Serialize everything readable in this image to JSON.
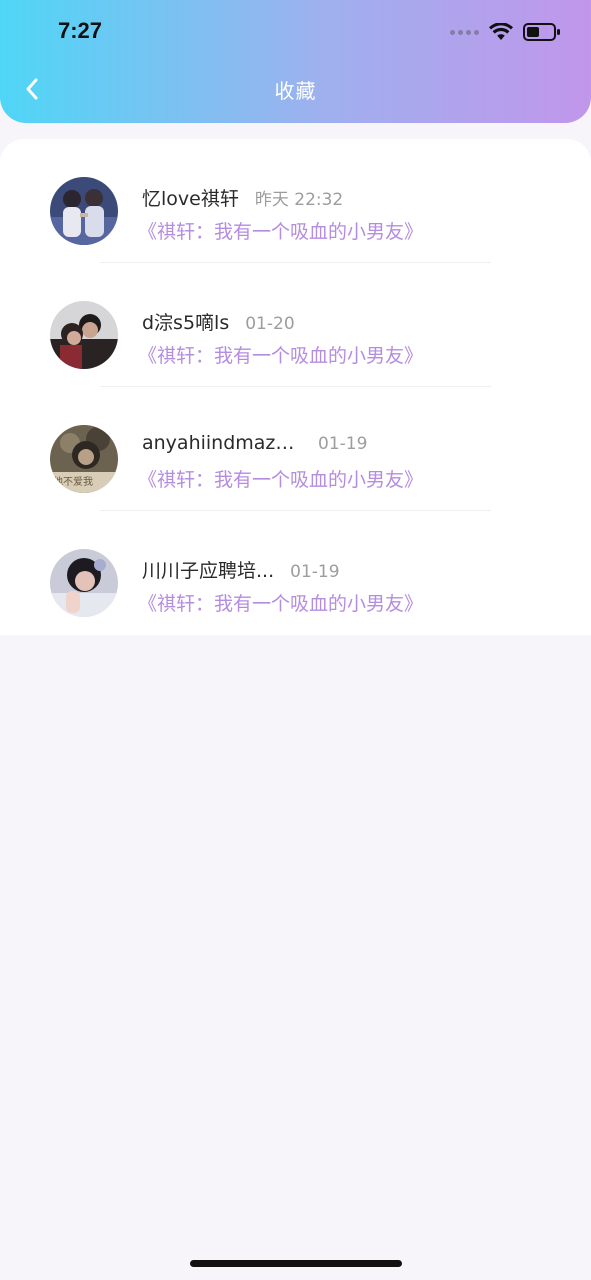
{
  "status_bar": {
    "time": "7:27"
  },
  "header": {
    "title": "收藏",
    "back_icon": "chevron-left-icon",
    "gradient": [
      "#4fd6f6",
      "#c196eb"
    ]
  },
  "items": [
    {
      "name": "忆love祺轩",
      "time": "昨天 22:32",
      "book": "《祺轩：我有一个吸血的小男友》",
      "avatar_icon": "avatar-photo"
    },
    {
      "name": "d淙s5嘀ls",
      "time": "01-20",
      "book": "《祺轩：我有一个吸血的小男友》",
      "avatar_icon": "avatar-photo"
    },
    {
      "name": "anyahiindmaza...",
      "time": "01-19",
      "book": "《祺轩：我有一个吸血的小男友》",
      "avatar_icon": "avatar-photo",
      "avatar_caption": "他不爱我"
    },
    {
      "name": "川川子应聘培...",
      "time": "01-19",
      "book": "《祺轩：我有一个吸血的小男友》",
      "avatar_icon": "avatar-photo"
    }
  ],
  "colors": {
    "accent_purple": "#b58de0",
    "background": "#f7f5f9"
  }
}
